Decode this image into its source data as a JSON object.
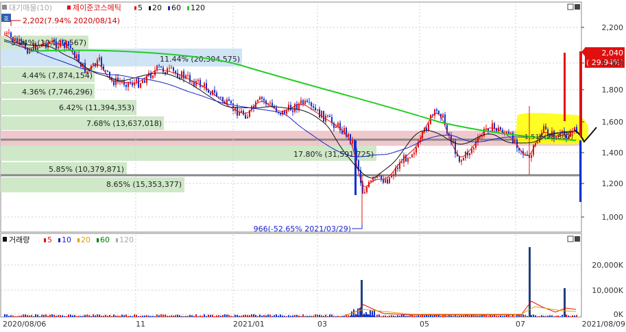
{
  "colors": {
    "up": "#e01010",
    "down": "#1030d0",
    "ma5": "#e01010",
    "ma20": "#111111",
    "ma60": "#1a22c8",
    "ma120": "#22cc22",
    "profile": "#cfe8c8",
    "profile_top": "#cfe4f4",
    "pink": "#f0c8cc",
    "gray_line": "#888888",
    "highlight": "#ffff00"
  },
  "price_panel": {
    "legend_prefix": "대기매물(10)",
    "stock_name": "제이준코스메틱",
    "legend_items": [
      {
        "label": "5",
        "color": "#e01010"
      },
      {
        "label": "20",
        "color": "#111111"
      },
      {
        "label": "60",
        "color": "#1a22c8"
      },
      {
        "label": "120",
        "color": "#22cc22"
      }
    ],
    "high_marker": "2,202(7.94% 2020/08/14)",
    "low_marker": "966(-52.65% 2021/03/29)",
    "current_price": "2,040",
    "current_change": "( 29.94%)",
    "y_ticks": [
      "2,200",
      "2,000",
      "1,800",
      "1,600",
      "1,400",
      "1,200",
      "1,000"
    ],
    "overlay_label": "1,516(28,803)"
  },
  "supply_bands": [
    {
      "label": "5.94% (10,540,567)"
    },
    {
      "label": "11.44% (20,304,575)"
    },
    {
      "label": "4.44% (7,874,154)"
    },
    {
      "label": "4.36% (7,746,296)"
    },
    {
      "label": "6.42% (11,394,353)"
    },
    {
      "label": "7.68% (13,637,018)"
    },
    {
      "label": "17.80% (31,591,725)"
    },
    {
      "label": "5.85% (10,379,871)"
    },
    {
      "label": "8.65% (15,353,377)"
    }
  ],
  "volume_panel": {
    "title": "거래량",
    "legend_items": [
      {
        "label": "5",
        "color": "#e01010"
      },
      {
        "label": "10",
        "color": "#1a22c8"
      },
      {
        "label": "20",
        "color": "#e0a000"
      },
      {
        "label": "60",
        "color": "#008000"
      },
      {
        "label": "120",
        "color": "#aaaaaa"
      }
    ],
    "y_ticks": [
      "20,000K",
      "10,000K",
      "0K"
    ]
  },
  "x_axis": {
    "ticks": [
      "2020/08/06",
      "11",
      "2021/01",
      "03",
      "05",
      "07",
      "2021/08/09"
    ]
  },
  "chart_data": [
    {
      "type": "candlestick",
      "title": "제이준코스메틱",
      "x": [
        "2020/08/06",
        "2020/11",
        "2021/01",
        "2021/03",
        "2021/05",
        "2021/07",
        "2021/08/09"
      ],
      "close": [
        2120,
        1870,
        1640,
        1500,
        1480,
        1510,
        2040
      ],
      "high": 2202,
      "low": 966,
      "last_close": 2040,
      "last_change_pct": 29.94,
      "ylim": [
        850,
        2300
      ],
      "supply_bands": [
        {
          "pct": 5.94,
          "volume": 10540567
        },
        {
          "pct": 11.44,
          "volume": 20304575
        },
        {
          "pct": 4.44,
          "volume": 7874154
        },
        {
          "pct": 4.36,
          "volume": 7746296
        },
        {
          "pct": 6.42,
          "volume": 11394353
        },
        {
          "pct": 7.68,
          "volume": 13637018
        },
        {
          "pct": 17.8,
          "volume": 31591725
        },
        {
          "pct": 5.85,
          "volume": 10379871
        },
        {
          "pct": 8.65,
          "volume": 15353377
        }
      ]
    },
    {
      "type": "bar",
      "title": "거래량",
      "ylim": [
        0,
        28000
      ],
      "spikes": [
        {
          "date": "2021/03/29",
          "value": 13500
        },
        {
          "date": "2021/07",
          "value": 27000
        },
        {
          "date": "2021/08/09",
          "value": 10500
        }
      ]
    }
  ]
}
